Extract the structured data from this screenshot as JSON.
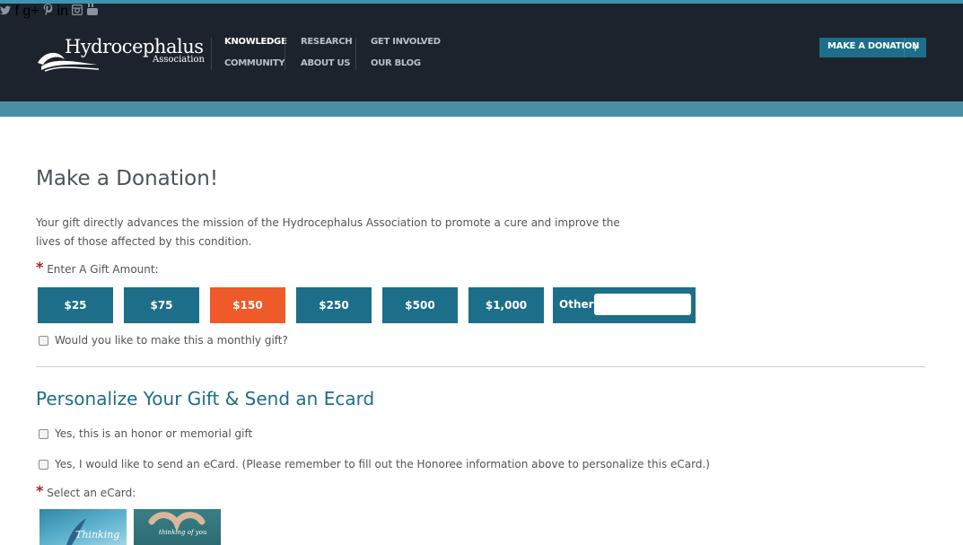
{
  "header": {
    "logo": {
      "brand": "Hydrocephalus",
      "sub": "Association"
    },
    "nav": {
      "col1": [
        "KNOWLEDGE",
        "COMMUNITY"
      ],
      "col2": [
        "RESEARCH",
        "ABOUT US"
      ],
      "col3": [
        "GET INVOLVED",
        "OUR BLOG"
      ]
    },
    "donate_button": {
      "label": "MAKE A DONATION",
      "plus": "+"
    },
    "social_icons": [
      "twitter-icon",
      "facebook-icon",
      "google-plus-icon",
      "pinterest-icon",
      "linkedin-icon",
      "instagram-icon",
      "youtube-icon"
    ]
  },
  "main": {
    "title": "Make a Donation!",
    "intro": "Your gift directly advances the mission of the Hydrocephalus Association to promote a cure and improve the lives of those affected by this condition.",
    "required_marker": "*",
    "amount_label": "Enter A Gift Amount:",
    "amounts": [
      "$25",
      "$75",
      "$150",
      "$250",
      "$500",
      "$1,000"
    ],
    "selected_amount": "$150",
    "other_label": "Other",
    "other_value": "",
    "monthly_label": "Would you like to make this a monthly gift?",
    "section_title": "Personalize Your Gift & Send an Ecard",
    "honor_label": "Yes, this is an honor or memorial gift",
    "ecard_optin_label": "Yes, I would like to send an eCard. (Please remember to fill out the Honoree information above to personalize this eCard.)",
    "ecard_select_label": "Select an eCard:",
    "ecards": [
      "Thinking",
      "thinking of you"
    ]
  },
  "colors": {
    "header_bg": "#1c232d",
    "accent_band": "#4a8ea3",
    "primary": "#1d6e88",
    "selected": "#ee5a2a",
    "required": "#b21f24"
  }
}
